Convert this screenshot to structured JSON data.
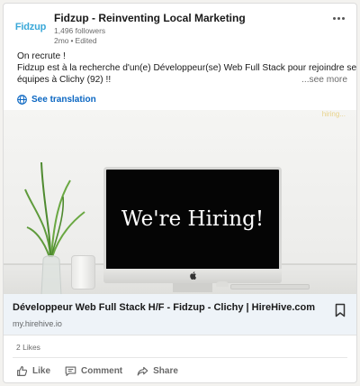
{
  "post": {
    "company_logo_text": "Fidzup",
    "company_name": "Fidzup - Reinventing Local Marketing",
    "followers": "1,496 followers",
    "time": "2mo",
    "separator": "•",
    "edited": "Edited",
    "text_line1": "On recrute !",
    "text_line2": "Fidzup est à la recherche d'un(e) Développeur(se) Web Full Stack pour rejoindre ses",
    "text_line3": "équipes à Clichy (92) !!",
    "see_more": "...see more",
    "see_translation": "See translation"
  },
  "media": {
    "screen_text": "We're Hiring!",
    "watermark_text": "hiring..."
  },
  "link": {
    "title": "Développeur Web Full Stack H/F - Fidzup - Clichy | HireHive.com",
    "domain": "my.hirehive.io"
  },
  "social": {
    "likes": "2 Likes"
  },
  "actions": {
    "like": "Like",
    "comment": "Comment",
    "share": "Share"
  },
  "colors": {
    "accent_blue": "#0a66c2",
    "logo_blue": "#3aa8d8",
    "link_bar_bg": "#eef3f8"
  },
  "icons": {
    "more": "ellipsis-icon",
    "translation": "globe-icon",
    "bookmark": "bookmark-icon",
    "like": "thumbs-up-icon",
    "comment": "comment-icon",
    "share": "share-arrow-icon",
    "apple": "apple-logo-icon"
  }
}
